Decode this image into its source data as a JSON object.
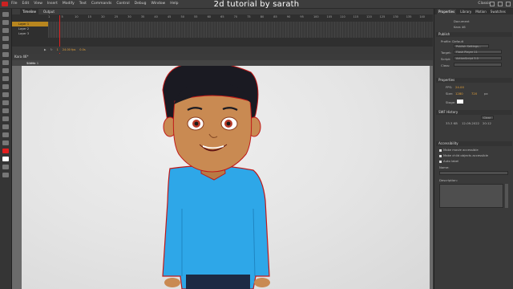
{
  "app": {
    "overlay_title": "2d tutorial by sarath",
    "menu": [
      "File",
      "Edit",
      "View",
      "Insert",
      "Modify",
      "Text",
      "Commands",
      "Control",
      "Debug",
      "Window",
      "Help"
    ],
    "workspace": "Classic"
  },
  "timeline": {
    "tabs": [
      "Timeline",
      "Output"
    ],
    "ruler": [
      "1",
      "5",
      "10",
      "15",
      "20",
      "25",
      "30",
      "35",
      "40",
      "45",
      "50",
      "55",
      "60",
      "65",
      "70",
      "75",
      "80",
      "85",
      "90",
      "95",
      "100",
      "105",
      "110",
      "115",
      "120",
      "125",
      "130",
      "135",
      "140",
      "145",
      "150",
      "155",
      "160",
      "165",
      "170"
    ],
    "layers": [
      "Layer 1",
      "Layer 2",
      "Layer 3"
    ],
    "frame_number": "1",
    "fps": "24.00 fps",
    "time": "0.0s"
  },
  "document": {
    "tab_name": "Kara 46*",
    "scene_label": "Scene 1",
    "zoom": "100%"
  },
  "properties": {
    "tabs": [
      "Properties",
      "Library",
      "Motion",
      "Swatches"
    ],
    "doc_type": "Document",
    "doc_name": "Kara 46",
    "publish_section": "Publish",
    "profile_label": "Profile: Default",
    "publish_settings_button": "Publish Settings...",
    "target_label": "Target:",
    "target_value": "Flash Player 11",
    "script_label": "Script:",
    "script_value": "ActionScript 3.0",
    "class_label": "Class:",
    "props_section": "Properties",
    "fps_label": "FPS:",
    "fps_value": "24.00",
    "size_label": "Size:",
    "width_value": "1280",
    "height_value": "720",
    "size_unit": "px",
    "stage_label": "Stage:",
    "swf_section": "SWF History",
    "swf_rows": [
      "33.3 KB",
      "12-09-2022",
      "20:12"
    ],
    "clear_button": "Clear",
    "access_section": "Accessibility",
    "access_items": [
      "Make movie accessible",
      "Make child objects accessible",
      "Auto label"
    ],
    "name_label": "Name:",
    "description_label": "Description:"
  },
  "colors": {
    "stroke": "#e21e1e",
    "fill": "#ffffff",
    "shirt": "#2ea7e8",
    "skin": "#c98a52",
    "hair": "#1a1a22"
  }
}
